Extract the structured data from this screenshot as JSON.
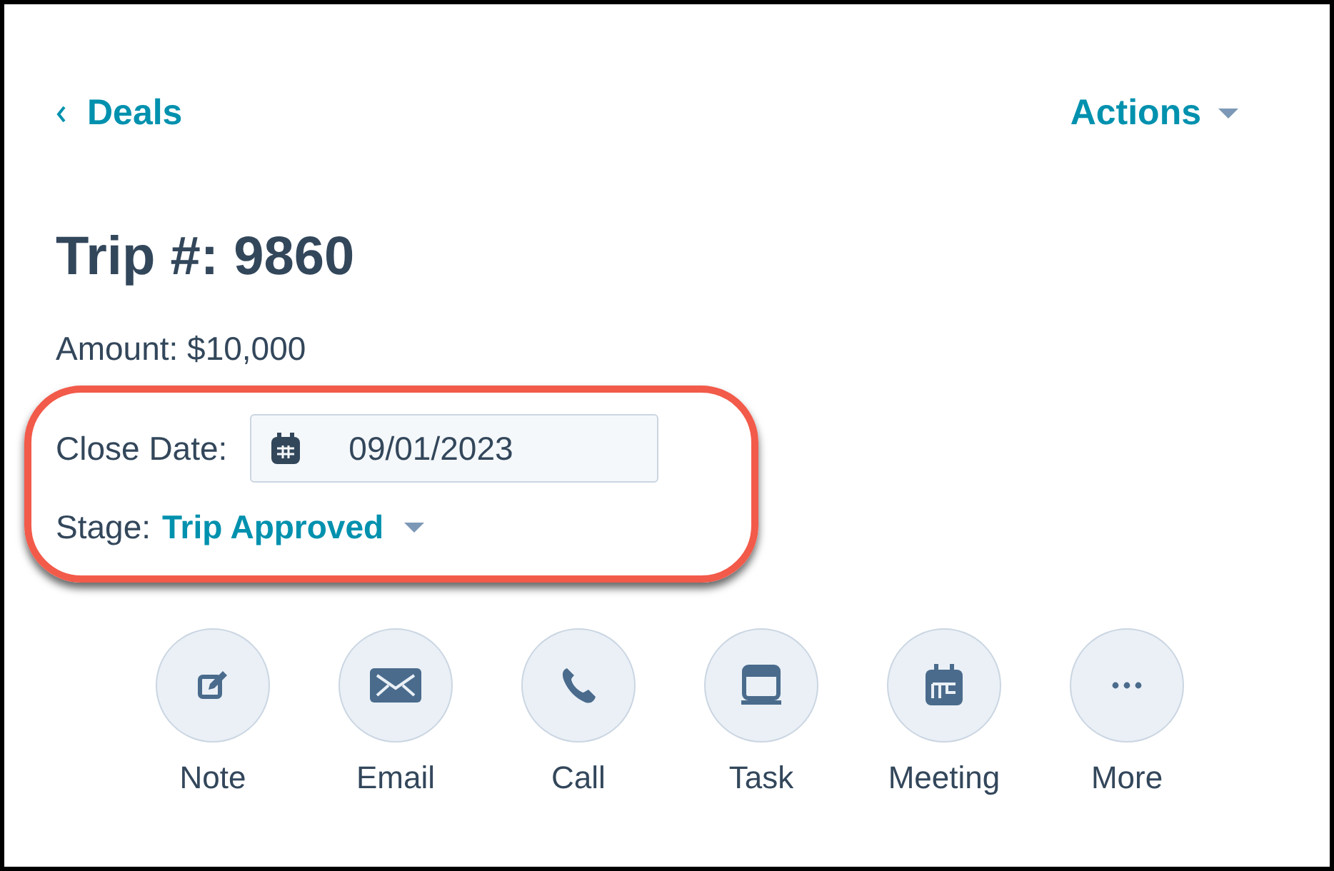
{
  "back_link": {
    "label": "Deals"
  },
  "actions_menu": {
    "label": "Actions"
  },
  "title": "Trip #: 9860",
  "amount": "Amount: $10,000",
  "close_date": {
    "label": "Close Date:",
    "value": "09/01/2023"
  },
  "stage": {
    "label": "Stage:",
    "value": "Trip Approved"
  },
  "activities": [
    {
      "kind": "note",
      "label": "Note"
    },
    {
      "kind": "email",
      "label": "Email"
    },
    {
      "kind": "call",
      "label": "Call"
    },
    {
      "kind": "task",
      "label": "Task"
    },
    {
      "kind": "meeting",
      "label": "Meeting"
    },
    {
      "kind": "more",
      "label": "More"
    }
  ]
}
